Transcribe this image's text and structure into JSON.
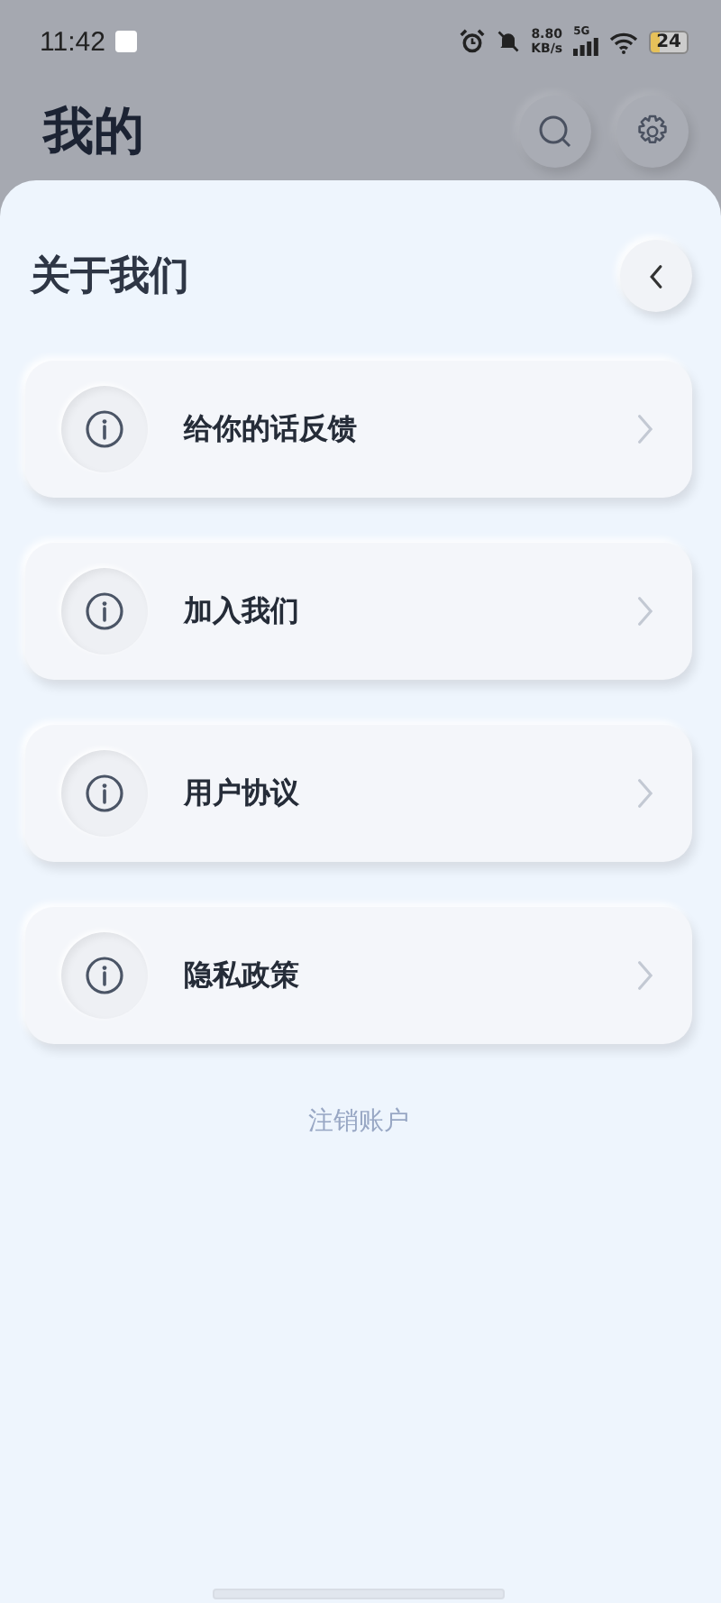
{
  "status_bar": {
    "time": "11:42",
    "net_speed": "8.80",
    "net_unit": "KB/s",
    "network": "5G",
    "battery": "24"
  },
  "page": {
    "title": "我的"
  },
  "sheet": {
    "title": "关于我们",
    "items": [
      {
        "label": "给你的话反馈"
      },
      {
        "label": "加入我们"
      },
      {
        "label": "用户协议"
      },
      {
        "label": "隐私政策"
      }
    ],
    "footer_link": "注销账户"
  }
}
